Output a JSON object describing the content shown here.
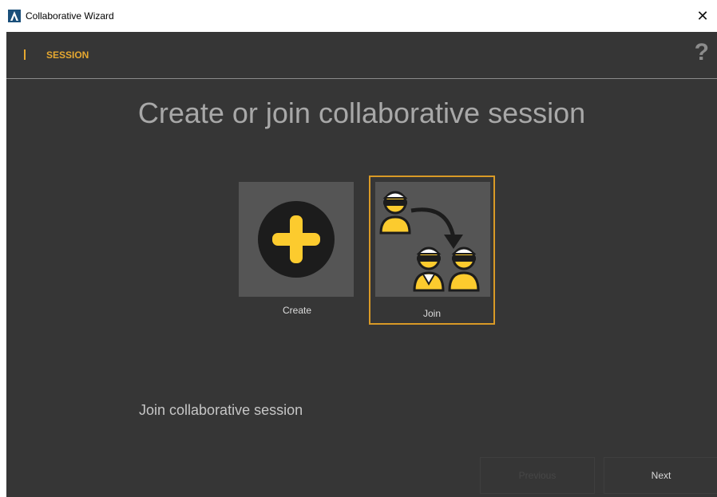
{
  "window": {
    "title": "Collaborative Wizard",
    "app_icon": "autodesk-a-icon",
    "close_glyph": "✕"
  },
  "header": {
    "section_label": "SESSION",
    "help_glyph": "?"
  },
  "main": {
    "title": "Create or join collaborative session",
    "options": [
      {
        "label": "Create",
        "icon": "plus-circle-icon",
        "selected": false
      },
      {
        "label": "Join",
        "icon": "users-vr-join-icon",
        "selected": true
      }
    ],
    "description": "Join collaborative session"
  },
  "footer": {
    "previous_label": "Previous",
    "next_label": "Next",
    "previous_enabled": false
  },
  "colors": {
    "accent": "#e6a830",
    "background": "#363636",
    "tile_bg": "#555555",
    "icon_yellow": "#fccb2e"
  }
}
